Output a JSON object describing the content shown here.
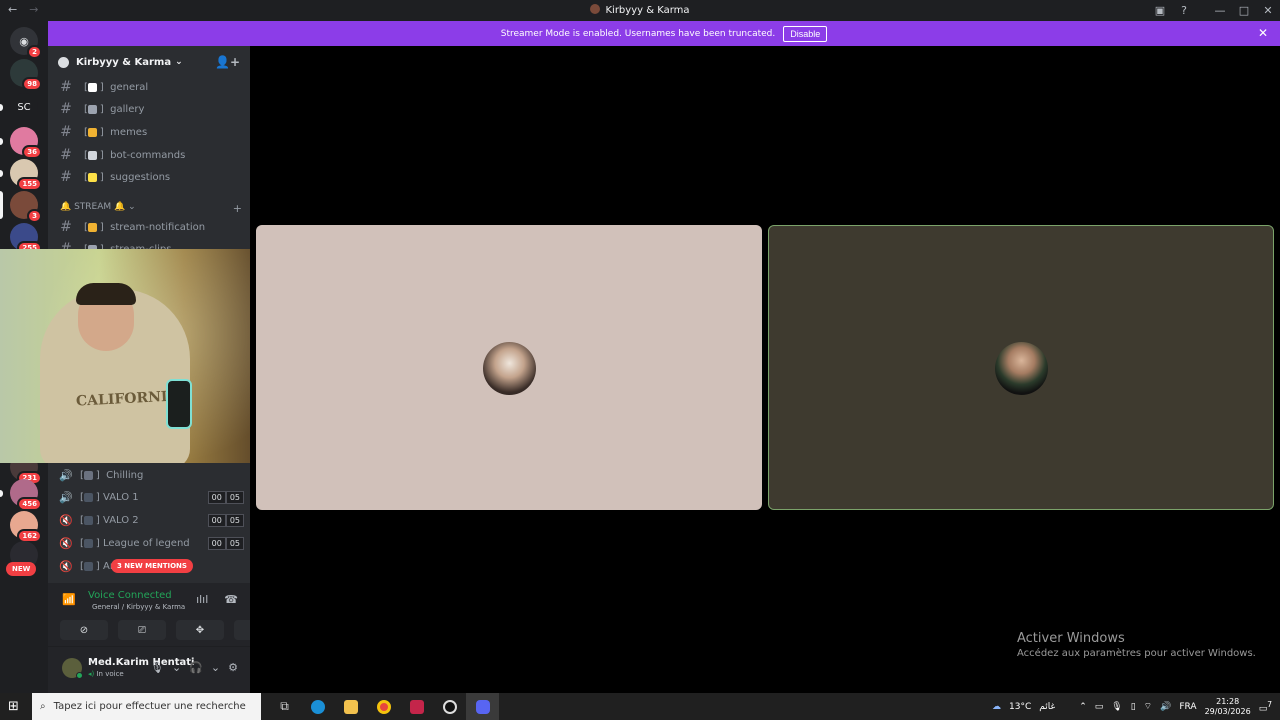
{
  "window": {
    "title": "Kirbyyy & Karma"
  },
  "banner": {
    "text": "Streamer Mode is enabled. Usernames have been truncated.",
    "button": "Disable"
  },
  "servers": [
    {
      "label": "",
      "badge": "2"
    },
    {
      "label": "",
      "badge": "98"
    },
    {
      "label": "SC",
      "badge": ""
    },
    {
      "label": "",
      "badge": "36"
    },
    {
      "label": "",
      "badge": "155"
    },
    {
      "label": "",
      "badge": "3"
    },
    {
      "label": "",
      "badge": "255"
    },
    {
      "label": "",
      "badge": "231"
    },
    {
      "label": "",
      "badge": "456"
    },
    {
      "label": "",
      "badge": "162"
    }
  ],
  "new_pill": "NEW",
  "guild": {
    "name": "Kirbyyy & Karma"
  },
  "text_channels": [
    {
      "name": "general"
    },
    {
      "name": "gallery"
    },
    {
      "name": "memes"
    },
    {
      "name": "bot-commands"
    },
    {
      "name": "suggestions"
    }
  ],
  "category": {
    "name": "STREAM"
  },
  "stream_channels": [
    {
      "name": "stream-notification"
    },
    {
      "name": "stream-clips"
    }
  ],
  "voice_channels": [
    {
      "name": "Chilling",
      "a": "",
      "b": ""
    },
    {
      "name": "VALO 1",
      "a": "00",
      "b": "05"
    },
    {
      "name": "VALO 2",
      "a": "00",
      "b": "05"
    },
    {
      "name": "League of legend",
      "a": "00",
      "b": "05"
    },
    {
      "name": "Ar",
      "a": "",
      "b": ""
    }
  ],
  "mentions_pill": "3 NEW MENTIONS",
  "voice": {
    "status": "Voice Connected",
    "channel": "General / Kirbyyy & Karma"
  },
  "user": {
    "name": "Med.Karim Hentati",
    "status": "In voice"
  },
  "webcam": {
    "shirt_text": "CALIFORNIA"
  },
  "windows_activation": {
    "title": "Activer Windows",
    "subtitle": "Accédez aux paramètres pour activer Windows."
  },
  "taskbar": {
    "search_placeholder": "Tapez ici pour effectuer une recherche",
    "weather": "13°C",
    "weather_desc": "غائم",
    "lang": "FRA",
    "time": "21:28",
    "date": "29/03/2026",
    "notifications": "7"
  },
  "colors": {
    "banner": "#8c3de8",
    "online": "#23a559",
    "badge": "#f23f43"
  }
}
